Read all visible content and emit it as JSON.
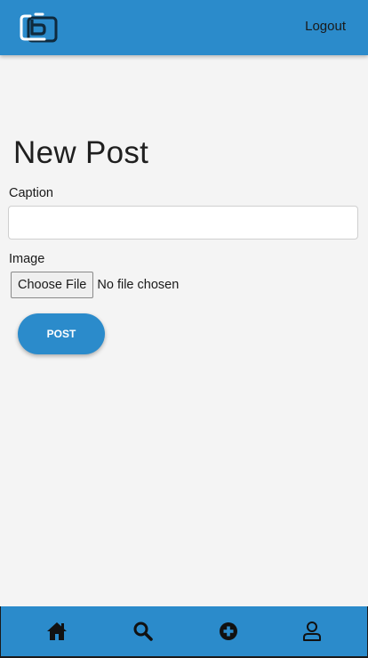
{
  "header": {
    "logo_icon": "camera-logo-icon",
    "logout_label": "Logout"
  },
  "main": {
    "title": "New Post",
    "caption_label": "Caption",
    "caption_value": "",
    "image_label": "Image",
    "file_button_label": "Choose File",
    "file_status": "No file chosen",
    "post_button_label": "POST"
  },
  "bottom_nav": {
    "items": [
      {
        "icon": "home-icon"
      },
      {
        "icon": "search-icon"
      },
      {
        "icon": "plus-circle-icon"
      },
      {
        "icon": "user-icon"
      }
    ]
  },
  "colors": {
    "accent": "#2b8bcb",
    "background": "#f4f4f4",
    "text": "#1a1a1a"
  }
}
